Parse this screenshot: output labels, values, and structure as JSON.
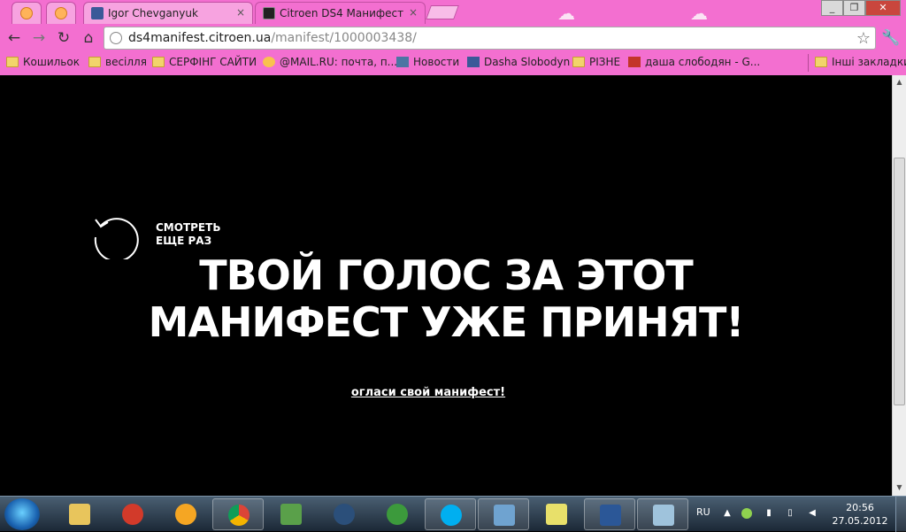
{
  "browser": {
    "tabs": [
      {
        "title": "Igor Chevganyuk",
        "active": false,
        "icon": "facebook-icon"
      },
      {
        "title": "Citroen DS4 Манифест",
        "active": true,
        "icon": "ds-logo-icon"
      }
    ],
    "tab_close_glyph": "×",
    "window_controls": [
      "_",
      "❐",
      "✕"
    ],
    "address": {
      "host": "ds4manifest.citroen.ua",
      "path": "/manifest/1000003438/"
    },
    "bookmarks": [
      {
        "label": "Кошильок",
        "icon": "folder-icon"
      },
      {
        "label": "весілля",
        "icon": "folder-icon"
      },
      {
        "label": "СЕРФІНГ САЙТИ",
        "icon": "folder-icon"
      },
      {
        "label": "@MAIL.RU: почта, п...",
        "icon": "mail-icon"
      },
      {
        "label": "Новости",
        "icon": "vk-icon"
      },
      {
        "label": "Dasha Slobodyn",
        "icon": "facebook-icon"
      },
      {
        "label": "РІЗНЕ",
        "icon": "folder-icon"
      },
      {
        "label": "даша слободян - G...",
        "icon": "google-plus-icon"
      }
    ],
    "other_bookmarks": "Інші закладки",
    "accent_color": "#f36fd0"
  },
  "page": {
    "replay_line1": "СМОТРЕТЬ",
    "replay_line2": "ЕЩЕ РАЗ",
    "headline_line1": "ТВОЙ ГОЛОС ЗА ЭТОТ",
    "headline_line2": "МАНИФЕСТ УЖЕ ПРИНЯТ!",
    "cta_link": "огласи свой манифест!"
  },
  "taskbar": {
    "apps": [
      "explorer",
      "ccleaner",
      "aimp",
      "chrome",
      "winrar",
      "euro-app",
      "utorrent",
      "skype",
      "image-viewer",
      "sticky-notes",
      "word",
      "notepad"
    ],
    "language": "RU",
    "time": "20:56",
    "date": "27.05.2012"
  }
}
